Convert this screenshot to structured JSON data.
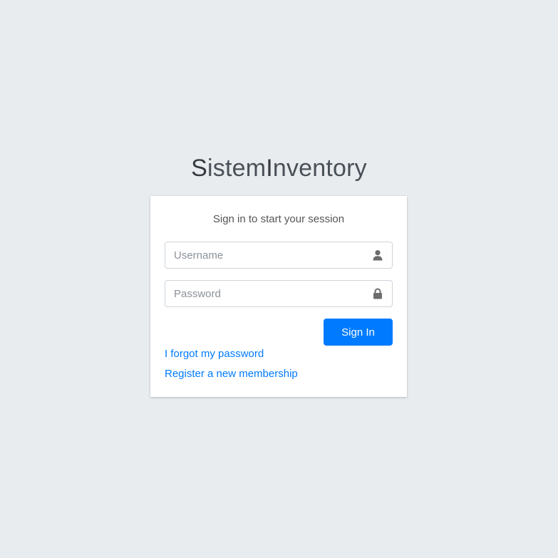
{
  "logo": {
    "part1_cap": "S",
    "part1_rest": "istem",
    "part2_cap": "I",
    "part2_rest": "nventory"
  },
  "login_box": {
    "message": "Sign in to start your session",
    "username": {
      "placeholder": "Username",
      "value": "",
      "icon": "user-icon"
    },
    "password": {
      "placeholder": "Password",
      "value": "",
      "icon": "lock-icon"
    },
    "sign_in_label": "Sign In",
    "forgot_password_label": "I forgot my password",
    "register_label": "Register a new membership"
  },
  "colors": {
    "background": "#e9ecef",
    "primary": "#007bff",
    "icon": "#6c6c6c"
  }
}
